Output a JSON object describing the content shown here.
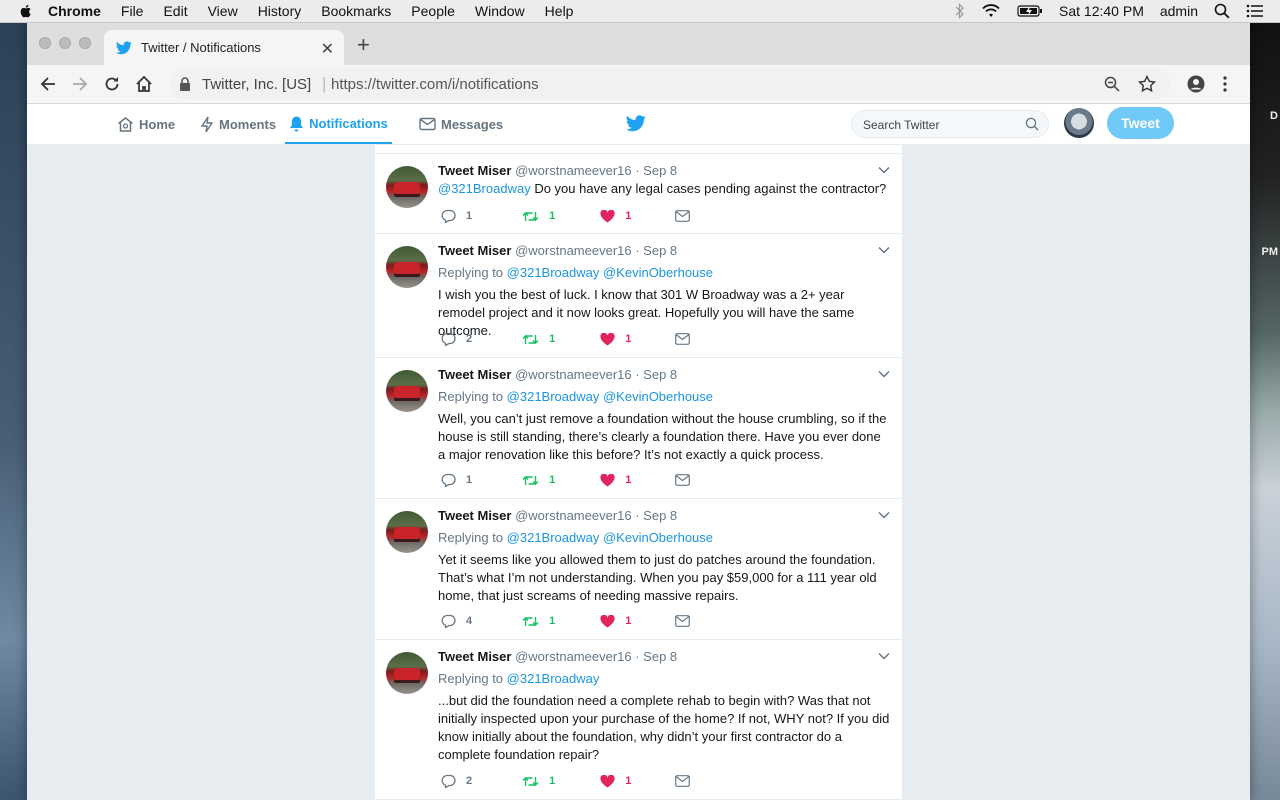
{
  "menubar": {
    "app": "Chrome",
    "items": [
      "File",
      "Edit",
      "View",
      "History",
      "Bookmarks",
      "People",
      "Window",
      "Help"
    ],
    "clock": "Sat 12:40 PM",
    "user": "admin"
  },
  "desktop": {
    "right_text_1": "D",
    "right_text_2": "PM"
  },
  "browser": {
    "tab_title": "Twitter / Notifications",
    "site_identity": "Twitter, Inc. [US]",
    "url": "https://twitter.com/i/notifications"
  },
  "twitter_nav": {
    "home": "Home",
    "moments": "Moments",
    "notifications": "Notifications",
    "messages": "Messages",
    "search_placeholder": "Search Twitter",
    "tweet_button": "Tweet"
  },
  "tweets": [
    {
      "name": "Tweet Miser",
      "handle": "@worstnameever16",
      "time": "· Sep 8",
      "mention": "@321Broadway",
      "text": " Do you have any legal cases pending against the contractor?",
      "replies": "1",
      "retweets": "1",
      "likes": "1"
    },
    {
      "name": "Tweet Miser",
      "handle": "@worstnameever16",
      "time": "· Sep 8",
      "replying_label": "Replying to",
      "reply_to": "@321Broadway @KevinOberhouse",
      "text": "I wish you the best of luck. I know that 301 W Broadway was a 2+ year remodel project and it now looks great. Hopefully you will have the same outcome.",
      "replies": "2",
      "retweets": "1",
      "likes": "1"
    },
    {
      "name": "Tweet Miser",
      "handle": "@worstnameever16",
      "time": "· Sep 8",
      "replying_label": "Replying to",
      "reply_to": "@321Broadway @KevinOberhouse",
      "text": "Well, you can’t just remove a foundation without the house crumbling, so if the house is still standing, there’s clearly a foundation there. Have you ever done a major renovation like this before? It’s not exactly a quick process.",
      "replies": "1",
      "retweets": "1",
      "likes": "1"
    },
    {
      "name": "Tweet Miser",
      "handle": "@worstnameever16",
      "time": "· Sep 8",
      "replying_label": "Replying to",
      "reply_to": "@321Broadway @KevinOberhouse",
      "text": "Yet it seems like you allowed them to just do patches around the foundation. That’s what I’m not understanding. When you pay $59,000 for a 111 year old home, that just screams of needing massive repairs.",
      "replies": "4",
      "retweets": "1",
      "likes": "1"
    },
    {
      "name": "Tweet Miser",
      "handle": "@worstnameever16",
      "time": "· Sep 8",
      "replying_label": "Replying to",
      "reply_to": "@321Broadway",
      "text": "...but did the foundation need a complete rehab to begin with? Was that not initially inspected upon your purchase of the home? If not, WHY not? If you did know initially about the foundation, why didn’t your first contractor do a complete foundation repair?",
      "replies": "2",
      "retweets": "1",
      "likes": "1"
    }
  ],
  "colors": {
    "twitter_blue": "#1da1f2",
    "link": "#1b95e0",
    "retweet": "#17bf63",
    "like": "#e0245e"
  }
}
